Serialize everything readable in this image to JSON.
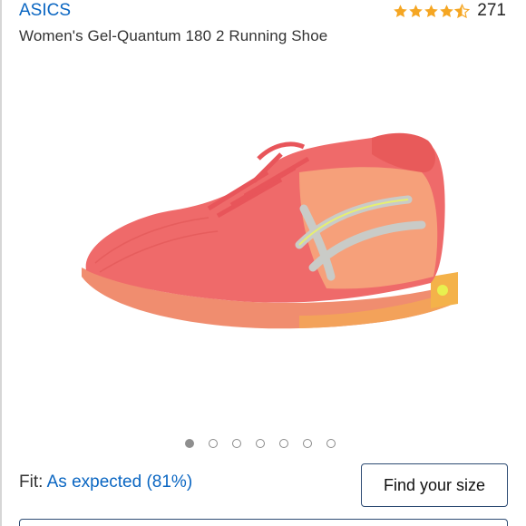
{
  "header": {
    "brand": "ASICS",
    "rating": {
      "stars": 4.5,
      "count": "271",
      "star_color": "#f5a623"
    },
    "title": "Women's Gel-Quantum 180 2 Running Shoe"
  },
  "gallery": {
    "image": "coral-running-shoe",
    "dot_count": 7,
    "active_index": 0
  },
  "fit": {
    "label": "Fit:",
    "value": "As expected (81%)"
  },
  "buttons": {
    "find_size": "Find your size"
  },
  "colors": {
    "link": "#0a66c2",
    "button_border": "#2d4b73"
  }
}
